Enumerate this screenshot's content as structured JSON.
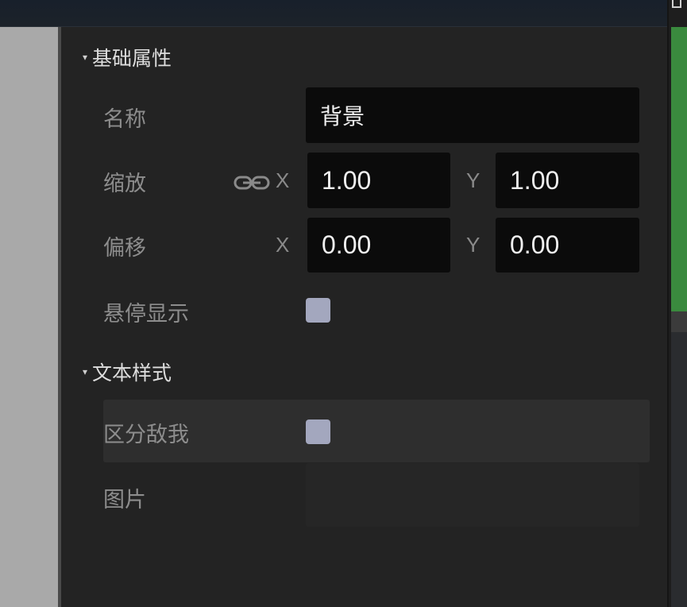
{
  "inspector": {
    "sections": {
      "basic": {
        "title": "基础属性"
      },
      "text_style": {
        "title": "文本样式"
      }
    },
    "name": {
      "label": "名称",
      "value": "背景"
    },
    "scale": {
      "label": "缩放",
      "x_label": "X",
      "x": "1.00",
      "y_label": "Y",
      "y": "1.00",
      "lock_icon": "link-icon"
    },
    "offset": {
      "label": "偏移",
      "x_label": "X",
      "x": "0.00",
      "y_label": "Y",
      "y": "0.00"
    },
    "hover_display": {
      "label": "悬停显示",
      "checked": false
    },
    "distinguish_enemy": {
      "label": "区分敌我",
      "checked": false
    },
    "image": {
      "label": "图片",
      "value": ""
    }
  },
  "colors": {
    "panel_bg": "#232323",
    "field_bg": "#0b0b0b",
    "checkbox": "#a3a7be",
    "accent_green": "#3a8a3e"
  }
}
